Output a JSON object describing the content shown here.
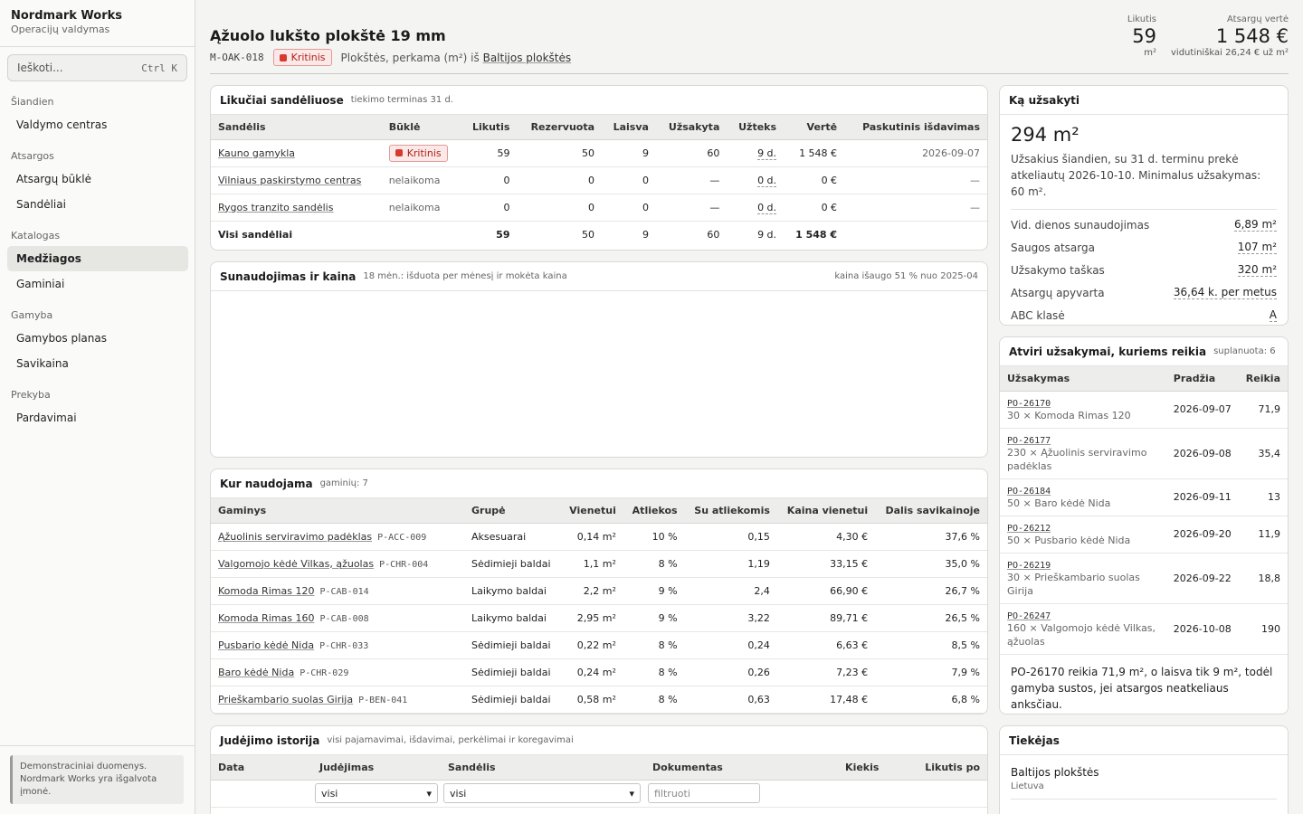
{
  "brand": {
    "name": "Nordmark Works",
    "subtitle": "Operacijų valdymas"
  },
  "search": {
    "placeholder": "Ieškoti...",
    "shortcut": "Ctrl K"
  },
  "nav": {
    "sections": [
      {
        "title": "Šiandien",
        "items": [
          "Valdymo centras"
        ]
      },
      {
        "title": "Atsargos",
        "items": [
          "Atsargų būklė",
          "Sandėliai"
        ]
      },
      {
        "title": "Katalogas",
        "items": [
          "Medžiagos",
          "Gaminiai"
        ]
      },
      {
        "title": "Gamyba",
        "items": [
          "Gamybos planas",
          "Savikaina"
        ]
      },
      {
        "title": "Prekyba",
        "items": [
          "Pardavimai"
        ]
      }
    ],
    "active": "Medžiagos"
  },
  "demo_note": "Demonstraciniai duomenys. Nordmark Works yra išgalvota įmonė.",
  "header": {
    "title": "Ąžuolo lukšto plokštė 19 mm",
    "code": "M-OAK-018",
    "status": "Kritinis",
    "description_prefix": "Plokštės, perkama (m²) iš",
    "supplier_link": "Baltijos plokštės",
    "kpi_stock": {
      "label": "Likutis",
      "value": "59",
      "sub": "m²"
    },
    "kpi_value": {
      "label": "Atsargų vertė",
      "value": "1 548 €",
      "sub": "vidutiniškai 26,24 € už m²"
    }
  },
  "stock": {
    "title": "Likučiai sandėliuose",
    "subtitle": "tiekimo terminas 31 d.",
    "columns": [
      "Sandėlis",
      "Būklė",
      "Likutis",
      "Rezervuota",
      "Laisva",
      "Užsakyta",
      "Užteks",
      "Vertė",
      "Paskutinis išdavimas"
    ],
    "rows": [
      {
        "name": "Kauno gamykla",
        "status": "Kritinis",
        "critical": true,
        "stock": "59",
        "reserved": "50",
        "free": "9",
        "ordered": "60",
        "lasts": "9 d.",
        "value": "1 548 €",
        "last": "2026-09-07"
      },
      {
        "name": "Vilniaus paskirstymo centras",
        "status": "nelaikoma",
        "critical": false,
        "stock": "0",
        "reserved": "0",
        "free": "0",
        "ordered": "—",
        "lasts": "0 d.",
        "value": "0 €",
        "last": "—"
      },
      {
        "name": "Rygos tranzito sandėlis",
        "status": "nelaikoma",
        "critical": false,
        "stock": "0",
        "reserved": "0",
        "free": "0",
        "ordered": "—",
        "lasts": "0 d.",
        "value": "0 €",
        "last": "—"
      }
    ],
    "total": {
      "name": "Visi sandėliai",
      "stock": "59",
      "reserved": "50",
      "free": "9",
      "ordered": "60",
      "lasts": "9 d.",
      "value": "1 548 €"
    }
  },
  "usage": {
    "title": "Sunaudojimas ir kaina",
    "subtitle": "18 mėn.: išduota per mėnesį ir mokėta kaina",
    "note": "kaina išaugo 51 % nuo 2025-04"
  },
  "where_used": {
    "title": "Kur naudojama",
    "subtitle": "gaminių: 7",
    "columns": [
      "Gaminys",
      "Grupė",
      "Vienetui",
      "Atliekos",
      "Su atliekomis",
      "Kaina vienetui",
      "Dalis savikainoje"
    ],
    "rows": [
      {
        "name": "Ąžuolinis serviravimo padėklas",
        "code": "P-ACC-009",
        "group": "Aksesuarai",
        "per_unit": "0,14 m²",
        "waste": "10 %",
        "with_waste": "0,15",
        "price": "4,30 €",
        "share": "37,6 %"
      },
      {
        "name": "Valgomojo kėdė Vilkas, ąžuolas",
        "code": "P-CHR-004",
        "group": "Sėdimieji baldai",
        "per_unit": "1,1 m²",
        "waste": "8 %",
        "with_waste": "1,19",
        "price": "33,15 €",
        "share": "35,0 %"
      },
      {
        "name": "Komoda Rimas 120",
        "code": "P-CAB-014",
        "group": "Laikymo baldai",
        "per_unit": "2,2 m²",
        "waste": "9 %",
        "with_waste": "2,4",
        "price": "66,90 €",
        "share": "26,7 %"
      },
      {
        "name": "Komoda Rimas 160",
        "code": "P-CAB-008",
        "group": "Laikymo baldai",
        "per_unit": "2,95 m²",
        "waste": "9 %",
        "with_waste": "3,22",
        "price": "89,71 €",
        "share": "26,5 %"
      },
      {
        "name": "Pusbario kėdė Nida",
        "code": "P-CHR-033",
        "group": "Sėdimieji baldai",
        "per_unit": "0,22 m²",
        "waste": "8 %",
        "with_waste": "0,24",
        "price": "6,63 €",
        "share": "8,5 %"
      },
      {
        "name": "Baro kėdė Nida",
        "code": "P-CHR-029",
        "group": "Sėdimieji baldai",
        "per_unit": "0,24 m²",
        "waste": "8 %",
        "with_waste": "0,26",
        "price": "7,23 €",
        "share": "7,9 %"
      },
      {
        "name": "Prieškambario suolas Girija",
        "code": "P-BEN-041",
        "group": "Sėdimieji baldai",
        "per_unit": "0,58 m²",
        "waste": "8 %",
        "with_waste": "0,63",
        "price": "17,48 €",
        "share": "6,8 %"
      }
    ]
  },
  "history": {
    "title": "Judėjimo istorija",
    "subtitle": "visi pajamavimai, išdavimai, perkėlimai ir koregavimai",
    "columns": [
      "Data",
      "Judėjimas",
      "Sandėlis",
      "Dokumentas",
      "Kiekis",
      "Likutis po"
    ],
    "filter_movement": "visi",
    "filter_warehouse": "visi",
    "filter_doc_placeholder": "filtruoti"
  },
  "order": {
    "title": "Ką užsakyti",
    "amount": "294 m²",
    "text": "Užsakius šiandien, su 31 d. terminu prekė atkeliautų 2026-10-10. Minimalus užsakymas: 60 m².",
    "stats": [
      {
        "label": "Vid. dienos sunaudojimas",
        "value": "6,89 m²"
      },
      {
        "label": "Saugos atsarga",
        "value": "107 m²"
      },
      {
        "label": "Užsakymo taškas",
        "value": "320 m²"
      },
      {
        "label": "Atsargų apyvarta",
        "value": "36,64 k. per metus"
      },
      {
        "label": "ABC klasė",
        "value": "A"
      }
    ]
  },
  "open_orders": {
    "title": "Atviri užsakymai, kuriems reikia",
    "subtitle": "suplanuota: 6",
    "columns": [
      "Užsakymas",
      "Pradžia",
      "Reikia"
    ],
    "rows": [
      {
        "id": "PO-26170",
        "desc": "30 × Komoda Rimas 120",
        "start": "2026-09-07",
        "need": "71,9"
      },
      {
        "id": "PO-26177",
        "desc": "230 × Ąžuolinis serviravimo padėklas",
        "start": "2026-09-08",
        "need": "35,4"
      },
      {
        "id": "PO-26184",
        "desc": "50 × Baro kėdė Nida",
        "start": "2026-09-11",
        "need": "13"
      },
      {
        "id": "PO-26212",
        "desc": "50 × Pusbario kėdė Nida",
        "start": "2026-09-20",
        "need": "11,9"
      },
      {
        "id": "PO-26219",
        "desc": "30 × Prieškambario suolas Girija",
        "start": "2026-09-22",
        "need": "18,8"
      },
      {
        "id": "PO-26247",
        "desc": "160 × Valgomojo kėdė Vilkas, ąžuolas",
        "start": "2026-10-08",
        "need": "190"
      }
    ],
    "warning": "PO-26170 reikia 71,9 m², o laisva tik 9 m², todėl gamyba sustos, jei atsargos neatkeliaus anksčiau."
  },
  "supplier": {
    "title": "Tiekėjas",
    "name": "Baltijos plokštės",
    "country": "Lietuva"
  },
  "colors": {
    "critical": "#d63a30",
    "critical_bg": "#fbe9e8"
  }
}
